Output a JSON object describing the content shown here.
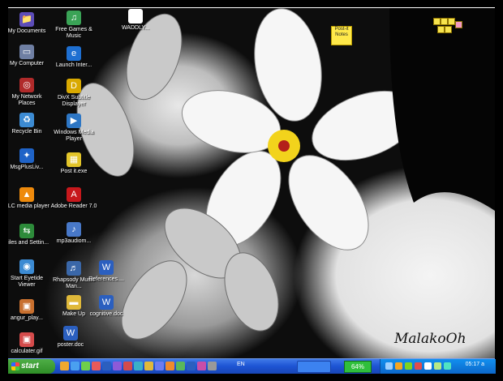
{
  "desktop": {
    "icons": [
      {
        "label": "My Documents",
        "glyph": "📁",
        "color": "#5d4db8"
      },
      {
        "label": "Free Games & Music",
        "glyph": "♫",
        "color": "#3aa356"
      },
      {
        "label": "WADDLY...",
        "glyph": "▤",
        "color": "#ffffff"
      },
      {
        "label": "My Computer",
        "glyph": "▭",
        "color": "#6f7fa3"
      },
      {
        "label": "Launch Inter...",
        "glyph": "e",
        "color": "#1e6fd1"
      },
      {
        "label": "My Network Places",
        "glyph": "◎",
        "color": "#b02a2a"
      },
      {
        "label": "DivX Subtitle Displayer",
        "glyph": "D",
        "color": "#d9a900"
      },
      {
        "label": "Recycle Bin",
        "glyph": "♻",
        "color": "#3c8bd3"
      },
      {
        "label": "Windows Media Player",
        "glyph": "▶",
        "color": "#2d76c4"
      },
      {
        "label": "MsgPlusLiv...",
        "glyph": "✦",
        "color": "#1f63c7"
      },
      {
        "label": "Post it.exe",
        "glyph": "▦",
        "color": "#e3c529"
      },
      {
        "label": "VLC media player",
        "glyph": "▲",
        "color": "#ee8a0c"
      },
      {
        "label": "Adobe Reader 7.0",
        "glyph": "A",
        "color": "#c7181c"
      },
      {
        "label": "Files and Settin...",
        "glyph": "⇆",
        "color": "#2d8b3a"
      },
      {
        "label": "mp3audiom...",
        "glyph": "♪",
        "color": "#4878c8"
      },
      {
        "label": "Start Eyetide Viewer",
        "glyph": "◉",
        "color": "#3c8bd3"
      },
      {
        "label": "Rhapsody Music Man...",
        "glyph": "♬",
        "color": "#3a67a8"
      },
      {
        "label": "References....",
        "glyph": "W",
        "color": "#2b5fbf"
      },
      {
        "label": "angur_play...",
        "glyph": "▣",
        "color": "#c8702f"
      },
      {
        "label": "Make Up",
        "glyph": "▬",
        "color": "#e0b93a"
      },
      {
        "label": "cognitive.doc",
        "glyph": "W",
        "color": "#2b5fbf"
      },
      {
        "label": "calculater.gif",
        "glyph": "▣",
        "color": "#d44b4b"
      },
      {
        "label": "poster.doc",
        "glyph": "W",
        "color": "#2b5fbf"
      }
    ],
    "sticky_note_label": "Post-it Notes",
    "signature": "MalakoOh"
  },
  "taskbar": {
    "start_label": "start",
    "language": "EN",
    "battery": "64%",
    "clock": "05:17 a",
    "accent": "#1d54d3"
  }
}
